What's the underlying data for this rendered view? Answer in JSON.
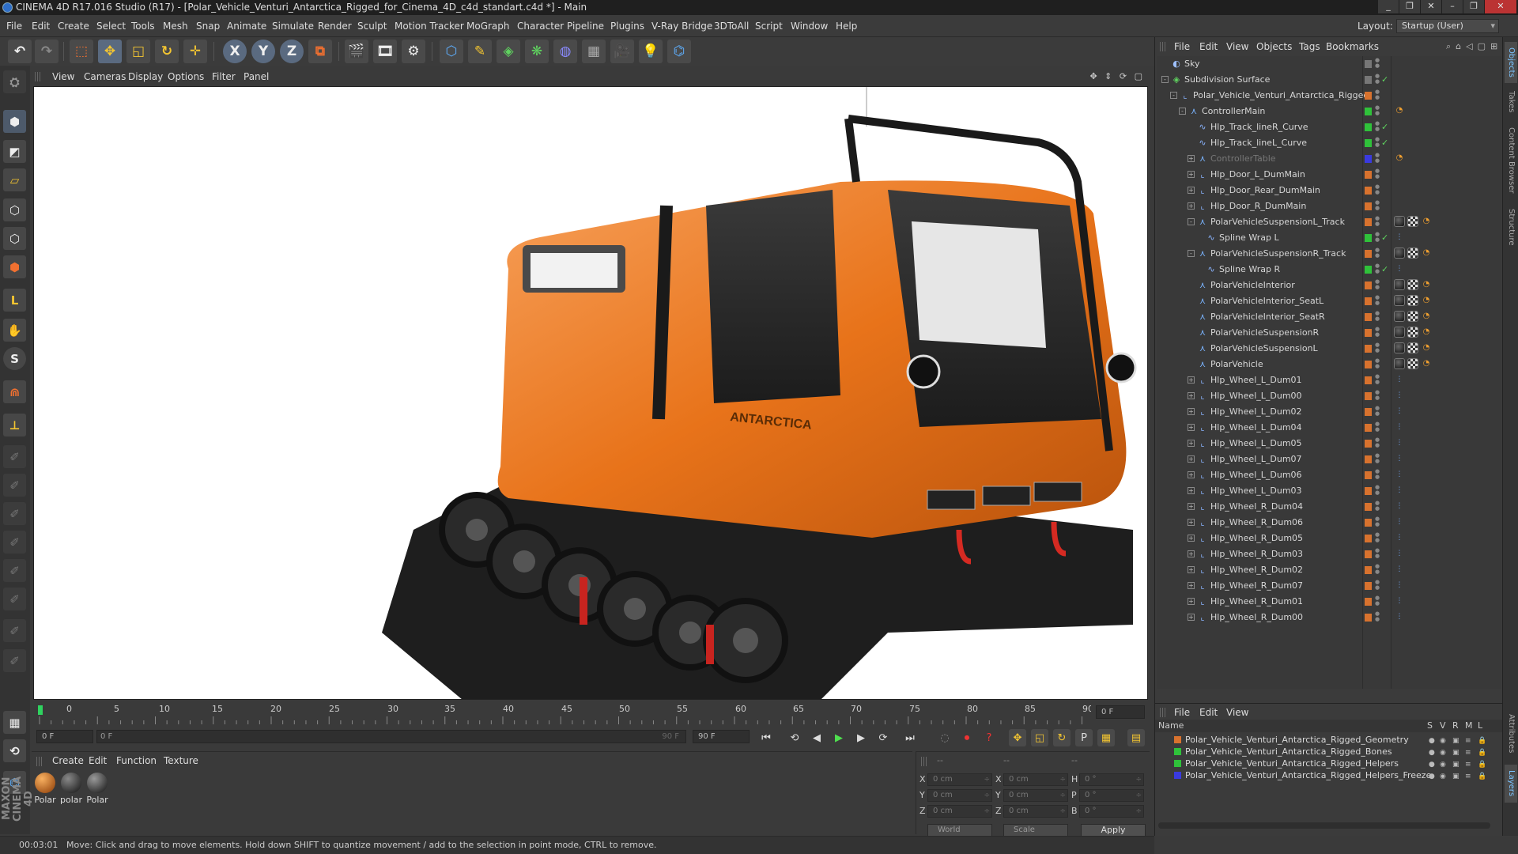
{
  "window": {
    "title": "CINEMA 4D R17.016 Studio (R17) - [Polar_Vehicle_Venturi_Antarctica_Rigged_for_Cinema_4D_c4d_standart.c4d *] - Main",
    "controls": [
      "–",
      "❐",
      "✕",
      "_",
      "❐",
      "✕"
    ]
  },
  "menubar": {
    "items": [
      "File",
      "Edit",
      "Create",
      "Select",
      "Tools",
      "Mesh",
      "Snap",
      "Animate",
      "Simulate",
      "Render",
      "Sculpt",
      "Motion Tracker",
      "MoGraph",
      "Character",
      "Pipeline",
      "Plugins",
      "V-Ray Bridge",
      "3DToAll",
      "Script",
      "Window",
      "Help"
    ],
    "layout_label": "Layout:",
    "layout_value": "Startup (User)"
  },
  "toolbar": {
    "axis": [
      "X",
      "Y",
      "Z"
    ]
  },
  "lefttools": {
    "labels": [
      "S"
    ]
  },
  "maxon": "MAXON CINEMA 4D",
  "viewport": {
    "menu": [
      "View",
      "Cameras",
      "Display",
      "Options",
      "Filter",
      "Panel"
    ],
    "nav": "✥ ⇕ ⟳ ▢",
    "vehicle_logo": "ANTARCTICA",
    "accent": "#e8731a"
  },
  "timeline": {
    "ticks": [
      "0",
      "5",
      "10",
      "15",
      "20",
      "25",
      "30",
      "35",
      "40",
      "45",
      "50",
      "55",
      "60",
      "65",
      "70",
      "75",
      "80",
      "85",
      "90"
    ],
    "current_frame": "0 F",
    "end_frame": "0 F"
  },
  "transport": {
    "start": "0 F",
    "range_start": "0 F",
    "range_end": "90 F",
    "end": "90 F"
  },
  "materials": {
    "menu": [
      "Create",
      "Edit",
      "Function",
      "Texture"
    ],
    "items": [
      {
        "label": "Polar",
        "kind": "orange"
      },
      {
        "label": "polar",
        "kind": "dark"
      },
      {
        "label": "Polar",
        "kind": "dark"
      }
    ]
  },
  "coords": {
    "header": [
      "--",
      "--",
      "--"
    ],
    "rows": [
      {
        "a": "X",
        "v1": "0 cm",
        "b": "X",
        "v2": "0 cm",
        "c": "H",
        "v3": "0 °"
      },
      {
        "a": "Y",
        "v1": "0 cm",
        "b": "Y",
        "v2": "0 cm",
        "c": "P",
        "v3": "0 °"
      },
      {
        "a": "Z",
        "v1": "0 cm",
        "b": "Z",
        "v2": "0 cm",
        "c": "B",
        "v3": "0 °"
      }
    ],
    "world": "World",
    "scale": "Scale",
    "apply": "Apply"
  },
  "status": {
    "time": "00:03:01",
    "message": "Move: Click and drag to move elements. Hold down SHIFT to quantize movement / add to the selection in point mode, CTRL to remove."
  },
  "objects": {
    "menu": [
      "File",
      "Edit",
      "View",
      "Objects",
      "Tags",
      "Bookmarks"
    ],
    "rows": [
      {
        "name": "Sky",
        "indent": 0,
        "icon": "sky",
        "expand": "",
        "layer": "",
        "dim": false,
        "check": "",
        "tags": []
      },
      {
        "name": "Subdivision Surface",
        "indent": 0,
        "icon": "subd",
        "expand": "-",
        "layer": "",
        "dim": false,
        "check": "✓",
        "tags": []
      },
      {
        "name": "Polar_Vehicle_Venturi_Antarctica_Rigged",
        "indent": 1,
        "icon": "null",
        "expand": "-",
        "layer": "#d8722e",
        "dim": false,
        "check": "",
        "tags": []
      },
      {
        "name": "ControllerMain",
        "indent": 2,
        "icon": "ctrl",
        "expand": "-",
        "layer": "#2fc23a",
        "dim": false,
        "check": "",
        "tags": [
          "sel"
        ]
      },
      {
        "name": "Hlp_Track_lineR_Curve",
        "indent": 3,
        "icon": "spline",
        "expand": "",
        "layer": "#2fc23a",
        "dim": false,
        "check": "✓",
        "tags": []
      },
      {
        "name": "Hlp_Track_lineL_Curve",
        "indent": 3,
        "icon": "spline",
        "expand": "",
        "layer": "#2fc23a",
        "dim": false,
        "check": "✓",
        "tags": []
      },
      {
        "name": "ControllerTable",
        "indent": 3,
        "icon": "ctrl",
        "expand": "+",
        "layer": "#3a3adf",
        "dim": true,
        "check": "",
        "tags": [
          "sel"
        ]
      },
      {
        "name": "Hlp_Door_L_DumMain",
        "indent": 3,
        "icon": "null",
        "expand": "+",
        "layer": "#d8722e",
        "dim": false,
        "check": "",
        "tags": []
      },
      {
        "name": "Hlp_Door_Rear_DumMain",
        "indent": 3,
        "icon": "null",
        "expand": "+",
        "layer": "#d8722e",
        "dim": false,
        "check": "",
        "tags": []
      },
      {
        "name": "Hlp_Door_R_DumMain",
        "indent": 3,
        "icon": "null",
        "expand": "+",
        "layer": "#d8722e",
        "dim": false,
        "check": "",
        "tags": []
      },
      {
        "name": "PolarVehicleSuspensionL_Track",
        "indent": 3,
        "icon": "ctrl",
        "expand": "-",
        "layer": "#d8722e",
        "dim": false,
        "check": "",
        "tags": [
          "ph",
          "ch",
          "sel"
        ]
      },
      {
        "name": "Spline Wrap L",
        "indent": 4,
        "icon": "wrap",
        "expand": "",
        "layer": "#2fc23a",
        "dim": false,
        "check": "✓",
        "tags": [
          "wr"
        ]
      },
      {
        "name": "PolarVehicleSuspensionR_Track",
        "indent": 3,
        "icon": "ctrl",
        "expand": "-",
        "layer": "#d8722e",
        "dim": false,
        "check": "",
        "tags": [
          "ph",
          "ch",
          "sel"
        ]
      },
      {
        "name": "Spline Wrap R",
        "indent": 4,
        "icon": "wrap",
        "expand": "",
        "layer": "#2fc23a",
        "dim": false,
        "check": "✓",
        "tags": [
          "wr"
        ]
      },
      {
        "name": "PolarVehicleInterior",
        "indent": 3,
        "icon": "ctrl",
        "expand": "",
        "layer": "#d8722e",
        "dim": false,
        "check": "",
        "tags": [
          "ph",
          "ch",
          "sel"
        ]
      },
      {
        "name": "PolarVehicleInterior_SeatL",
        "indent": 3,
        "icon": "ctrl",
        "expand": "",
        "layer": "#d8722e",
        "dim": false,
        "check": "",
        "tags": [
          "ph",
          "ch",
          "sel"
        ]
      },
      {
        "name": "PolarVehicleInterior_SeatR",
        "indent": 3,
        "icon": "ctrl",
        "expand": "",
        "layer": "#d8722e",
        "dim": false,
        "check": "",
        "tags": [
          "ph",
          "ch",
          "sel"
        ]
      },
      {
        "name": "PolarVehicleSuspensionR",
        "indent": 3,
        "icon": "ctrl",
        "expand": "",
        "layer": "#d8722e",
        "dim": false,
        "check": "",
        "tags": [
          "ph",
          "ch",
          "sel"
        ]
      },
      {
        "name": "PolarVehicleSuspensionL",
        "indent": 3,
        "icon": "ctrl",
        "expand": "",
        "layer": "#d8722e",
        "dim": false,
        "check": "",
        "tags": [
          "ph",
          "ch",
          "sel"
        ]
      },
      {
        "name": "PolarVehicle",
        "indent": 3,
        "icon": "ctrl",
        "expand": "",
        "layer": "#d8722e",
        "dim": false,
        "check": "",
        "tags": [
          "ph",
          "ch",
          "sel"
        ]
      },
      {
        "name": "Hlp_Wheel_L_Dum01",
        "indent": 3,
        "icon": "null",
        "expand": "+",
        "layer": "#d8722e",
        "dim": false,
        "check": "",
        "tags": [
          "wr"
        ]
      },
      {
        "name": "Hlp_Wheel_L_Dum00",
        "indent": 3,
        "icon": "null",
        "expand": "+",
        "layer": "#d8722e",
        "dim": false,
        "check": "",
        "tags": [
          "wr"
        ]
      },
      {
        "name": "Hlp_Wheel_L_Dum02",
        "indent": 3,
        "icon": "null",
        "expand": "+",
        "layer": "#d8722e",
        "dim": false,
        "check": "",
        "tags": [
          "wr"
        ]
      },
      {
        "name": "Hlp_Wheel_L_Dum04",
        "indent": 3,
        "icon": "null",
        "expand": "+",
        "layer": "#d8722e",
        "dim": false,
        "check": "",
        "tags": [
          "wr"
        ]
      },
      {
        "name": "Hlp_Wheel_L_Dum05",
        "indent": 3,
        "icon": "null",
        "expand": "+",
        "layer": "#d8722e",
        "dim": false,
        "check": "",
        "tags": [
          "wr"
        ]
      },
      {
        "name": "Hlp_Wheel_L_Dum07",
        "indent": 3,
        "icon": "null",
        "expand": "+",
        "layer": "#d8722e",
        "dim": false,
        "check": "",
        "tags": [
          "wr"
        ]
      },
      {
        "name": "Hlp_Wheel_L_Dum06",
        "indent": 3,
        "icon": "null",
        "expand": "+",
        "layer": "#d8722e",
        "dim": false,
        "check": "",
        "tags": [
          "wr"
        ]
      },
      {
        "name": "Hlp_Wheel_L_Dum03",
        "indent": 3,
        "icon": "null",
        "expand": "+",
        "layer": "#d8722e",
        "dim": false,
        "check": "",
        "tags": [
          "wr"
        ]
      },
      {
        "name": "Hlp_Wheel_R_Dum04",
        "indent": 3,
        "icon": "null",
        "expand": "+",
        "layer": "#d8722e",
        "dim": false,
        "check": "",
        "tags": [
          "wr"
        ]
      },
      {
        "name": "Hlp_Wheel_R_Dum06",
        "indent": 3,
        "icon": "null",
        "expand": "+",
        "layer": "#d8722e",
        "dim": false,
        "check": "",
        "tags": [
          "wr"
        ]
      },
      {
        "name": "Hlp_Wheel_R_Dum05",
        "indent": 3,
        "icon": "null",
        "expand": "+",
        "layer": "#d8722e",
        "dim": false,
        "check": "",
        "tags": [
          "wr"
        ]
      },
      {
        "name": "Hlp_Wheel_R_Dum03",
        "indent": 3,
        "icon": "null",
        "expand": "+",
        "layer": "#d8722e",
        "dim": false,
        "check": "",
        "tags": [
          "wr"
        ]
      },
      {
        "name": "Hlp_Wheel_R_Dum02",
        "indent": 3,
        "icon": "null",
        "expand": "+",
        "layer": "#d8722e",
        "dim": false,
        "check": "",
        "tags": [
          "wr"
        ]
      },
      {
        "name": "Hlp_Wheel_R_Dum07",
        "indent": 3,
        "icon": "null",
        "expand": "+",
        "layer": "#d8722e",
        "dim": false,
        "check": "",
        "tags": [
          "wr"
        ]
      },
      {
        "name": "Hlp_Wheel_R_Dum01",
        "indent": 3,
        "icon": "null",
        "expand": "+",
        "layer": "#d8722e",
        "dim": false,
        "check": "",
        "tags": [
          "wr"
        ]
      },
      {
        "name": "Hlp_Wheel_R_Dum00",
        "indent": 3,
        "icon": "null",
        "expand": "+",
        "layer": "#d8722e",
        "dim": false,
        "check": "",
        "tags": [
          "wr"
        ]
      }
    ]
  },
  "layers": {
    "menu": [
      "File",
      "Edit",
      "View"
    ],
    "header": {
      "name": "Name",
      "cols": [
        "S",
        "V",
        "R",
        "M",
        "L"
      ]
    },
    "rows": [
      {
        "name": "Polar_Vehicle_Venturi_Antarctica_Rigged_Geometry",
        "color": "#d8722e"
      },
      {
        "name": "Polar_Vehicle_Venturi_Antarctica_Rigged_Bones",
        "color": "#2fc23a"
      },
      {
        "name": "Polar_Vehicle_Venturi_Antarctica_Rigged_Helpers",
        "color": "#2fc23a"
      },
      {
        "name": "Polar_Vehicle_Venturi_Antarctica_Rigged_Helpers_Freeze",
        "color": "#3a3adf"
      }
    ]
  },
  "rightstrip": {
    "tabs": [
      "Objects",
      "Takes",
      "Content Browser",
      "Structure",
      "Attributes",
      "Layers"
    ]
  }
}
